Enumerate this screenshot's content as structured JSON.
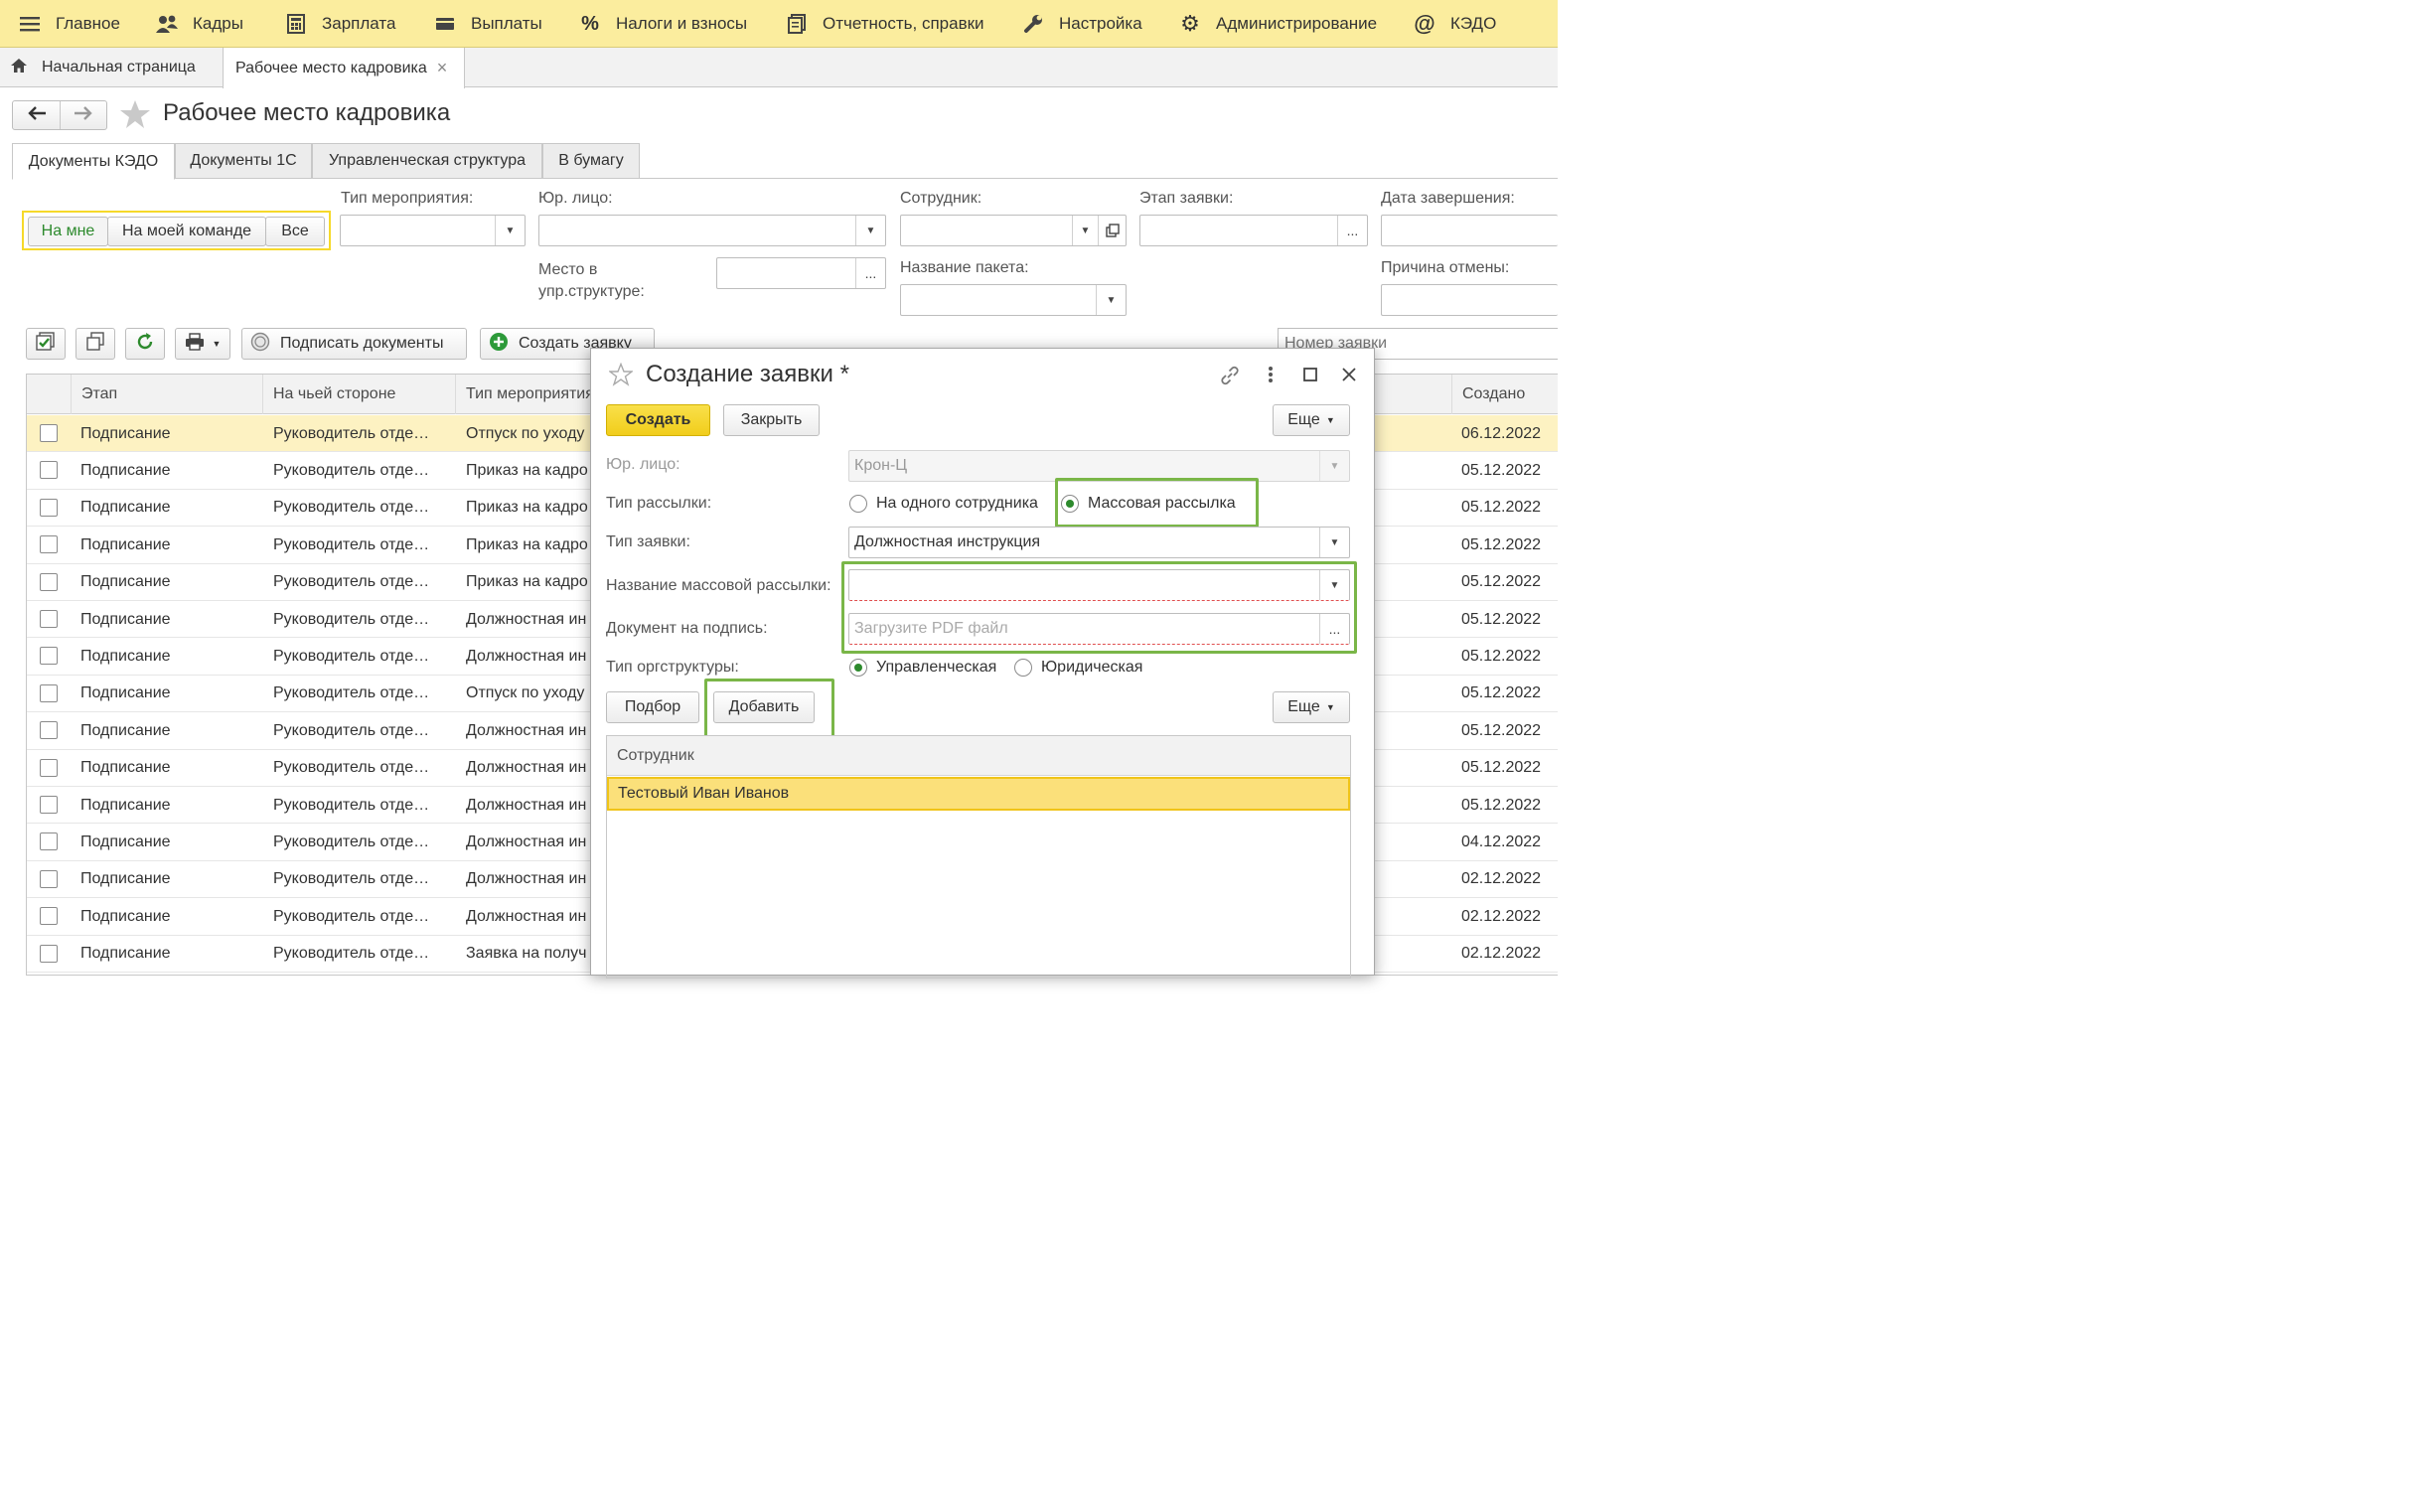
{
  "top_menu": [
    {
      "label": "Главное",
      "icon": "hamburger-icon"
    },
    {
      "label": "Кадры",
      "icon": "people-icon"
    },
    {
      "label": "Зарплата",
      "icon": "calculator-icon"
    },
    {
      "label": "Выплаты",
      "icon": "card-icon"
    },
    {
      "label": "Налоги и взносы",
      "icon": "percent-icon"
    },
    {
      "label": "Отчетность, справки",
      "icon": "report-icon"
    },
    {
      "label": "Настройка",
      "icon": "wrench-icon"
    },
    {
      "label": "Администрирование",
      "icon": "gear-icon"
    },
    {
      "label": "КЭДО",
      "icon": "at-icon"
    }
  ],
  "window_tabs": {
    "home": "Начальная страница",
    "current": "Рабочее место кадровика",
    "close": "×"
  },
  "page_title": "Рабочее место кадровика",
  "section_tabs": [
    "Документы КЭДО",
    "Документы 1С",
    "Управленческая структура",
    "В бумагу"
  ],
  "scope_filter": [
    "На мне",
    "На моей команде",
    "Все"
  ],
  "filters": {
    "event_type": "Тип мероприятия:",
    "legal_entity": "Юр. лицо:",
    "employee": "Сотрудник:",
    "stage": "Этап заявки:",
    "end_date": "Дата завершения:",
    "place_line1": "Место в",
    "place_line2": "упр.структуре:",
    "package_name": "Название пакета:",
    "cancel_reason": "Причина отмены:"
  },
  "toolbar": {
    "sign_docs": "Подписать документы",
    "create_request": "Создать заявку",
    "request_number_placeholder": "Номер заявки"
  },
  "table": {
    "headers": [
      "Этап",
      "На чьей стороне",
      "Тип мероприятия",
      "Создано"
    ],
    "rows": [
      [
        "Подписание",
        "Руководитель отде…",
        "Отпуск по уходу",
        "06.12.2022"
      ],
      [
        "Подписание",
        "Руководитель отде…",
        "Приказ на кадро",
        "05.12.2022"
      ],
      [
        "Подписание",
        "Руководитель отде…",
        "Приказ на кадро",
        "05.12.2022"
      ],
      [
        "Подписание",
        "Руководитель отде…",
        "Приказ на кадро",
        "05.12.2022"
      ],
      [
        "Подписание",
        "Руководитель отде…",
        "Приказ на кадро",
        "05.12.2022"
      ],
      [
        "Подписание",
        "Руководитель отде…",
        "Должностная ин",
        "05.12.2022"
      ],
      [
        "Подписание",
        "Руководитель отде…",
        "Должностная ин",
        "05.12.2022"
      ],
      [
        "Подписание",
        "Руководитель отде…",
        "Отпуск по уходу",
        "05.12.2022"
      ],
      [
        "Подписание",
        "Руководитель отде…",
        "Должностная ин",
        "05.12.2022"
      ],
      [
        "Подписание",
        "Руководитель отде…",
        "Должностная ин",
        "05.12.2022"
      ],
      [
        "Подписание",
        "Руководитель отде…",
        "Должностная ин",
        "05.12.2022"
      ],
      [
        "Подписание",
        "Руководитель отде…",
        "Должностная ин",
        "04.12.2022"
      ],
      [
        "Подписание",
        "Руководитель отде…",
        "Должностная ин",
        "02.12.2022"
      ],
      [
        "Подписание",
        "Руководитель отде…",
        "Должностная ин",
        "02.12.2022"
      ],
      [
        "Подписание",
        "Руководитель отде…",
        "Заявка на получ",
        "02.12.2022"
      ]
    ]
  },
  "dialog": {
    "title": "Создание заявки *",
    "create_btn": "Создать",
    "close_btn": "Закрыть",
    "more_btn": "Еще",
    "legal_entity_label": "Юр. лицо:",
    "legal_entity_value": "Крон-Ц",
    "mailing_type_label": "Тип рассылки:",
    "mailing_single": "На одного сотрудника",
    "mailing_mass": "Массовая рассылка",
    "request_type_label": "Тип заявки:",
    "request_type_value": "Должностная инструкция",
    "mass_name_label": "Название массовой рассылки:",
    "doc_label": "Документ на подпись:",
    "doc_placeholder": "Загрузите PDF файл",
    "org_type_label": "Тип оргструктуры:",
    "org_managerial": "Управленческая",
    "org_legal": "Юридическая",
    "select_btn": "Подбор",
    "add_btn": "Добавить",
    "list_header": "Сотрудник",
    "list_rows": [
      "Тестовый Иван Иванов"
    ]
  },
  "colors": {
    "menu_bg": "#fbed9e",
    "accent_yellow": "#f6d92a",
    "highlight_green": "#7ab648",
    "active_green": "#2d8a2d"
  }
}
